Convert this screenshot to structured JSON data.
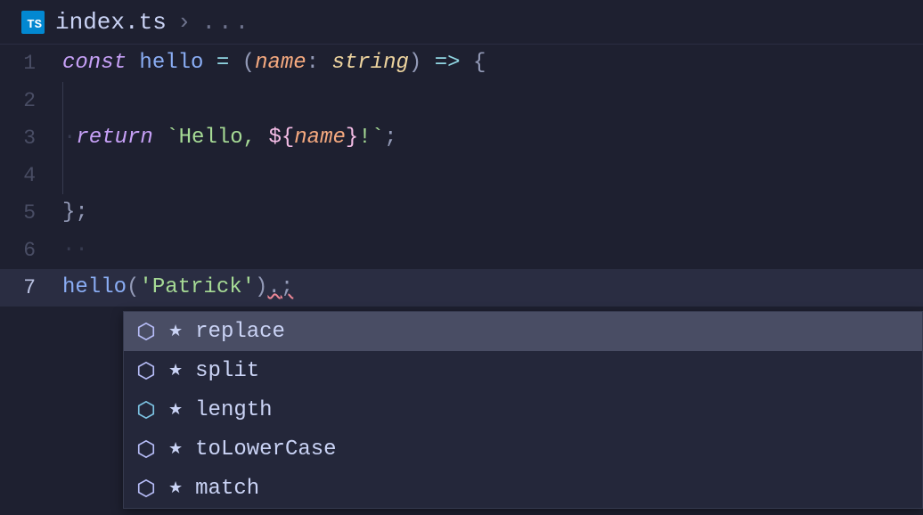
{
  "tab": {
    "badge": "TS",
    "filename": "index.ts",
    "breadcrumb_sep": "›",
    "breadcrumb_dots": "..."
  },
  "gutter": {
    "lines": [
      "1",
      "2",
      "3",
      "4",
      "5",
      "6",
      "7"
    ],
    "active": 7
  },
  "code": {
    "line1": {
      "const": "const",
      "hello": "hello",
      "eq": "=",
      "lparen": "(",
      "name": "name",
      "colon": ":",
      "type": "string",
      "rparen": ")",
      "arrow": "=>",
      "lbrace": "{"
    },
    "line3": {
      "return": "return",
      "tick1": "`",
      "str1": "Hello, ",
      "interp_open": "${",
      "name": "name",
      "interp_close": "}",
      "str2": "!",
      "tick2": "`",
      "semi": ";"
    },
    "line5": {
      "rbrace": "}",
      "semi": ";"
    },
    "line7": {
      "call": "hello",
      "lparen": "(",
      "arg": "'Patrick'",
      "rparen": ")",
      "dot": ".",
      "semi": ";"
    }
  },
  "autocomplete": {
    "items": [
      {
        "label": "replace",
        "kind": "method",
        "star": "★"
      },
      {
        "label": "split",
        "kind": "method",
        "star": "★"
      },
      {
        "label": "length",
        "kind": "property",
        "star": "★"
      },
      {
        "label": "toLowerCase",
        "kind": "method",
        "star": "★"
      },
      {
        "label": "match",
        "kind": "method",
        "star": "★"
      }
    ],
    "selected": 0
  }
}
